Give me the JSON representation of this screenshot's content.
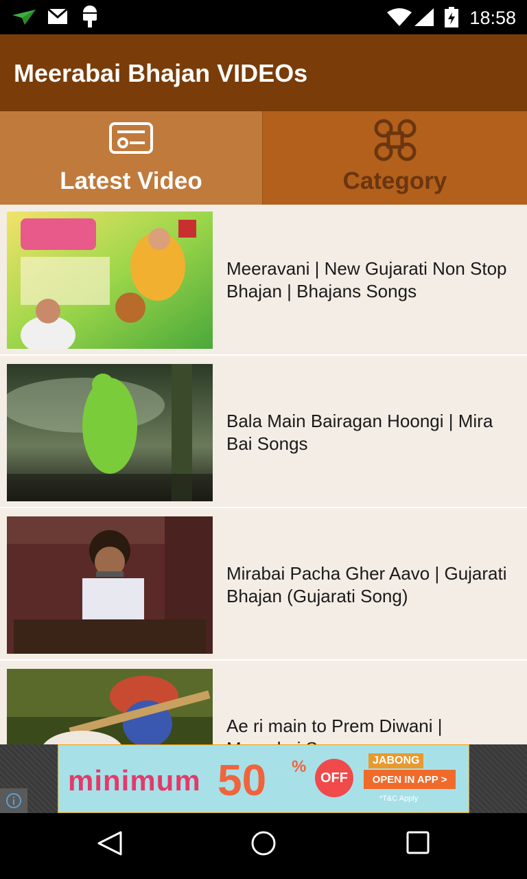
{
  "status_bar": {
    "time": "18:58"
  },
  "app_bar": {
    "title": "Meerabai Bhajan VIDEOs"
  },
  "tabs": [
    {
      "label": "Latest Video",
      "icon": "video-card-icon",
      "selected": true
    },
    {
      "label": "Category",
      "icon": "command-icon",
      "selected": false
    }
  ],
  "videos": [
    {
      "title": "Meeravani | New Gujarati Non Stop Bhajan | Bhajans Songs"
    },
    {
      "title": "Bala Main Bairagan Hoongi | Mira Bai Songs"
    },
    {
      "title": "Mirabai Pacha Gher Aavo | Gujarati Bhajan (Gujarati Song)"
    },
    {
      "title": "Ae ri main to Prem Diwani | Meerabai Songs"
    }
  ],
  "ad": {
    "headline": "minimum",
    "discount": "50",
    "percent": "%",
    "off": "OFF",
    "brand": "JABONG",
    "cta": "OPEN IN APP >",
    "terms": "*T&C Apply"
  },
  "colors": {
    "app_bar": "#7a3c08",
    "tab_selected": "#c07a3c",
    "tab_unselected": "#b2601b",
    "list_background": "#f4ede6"
  }
}
